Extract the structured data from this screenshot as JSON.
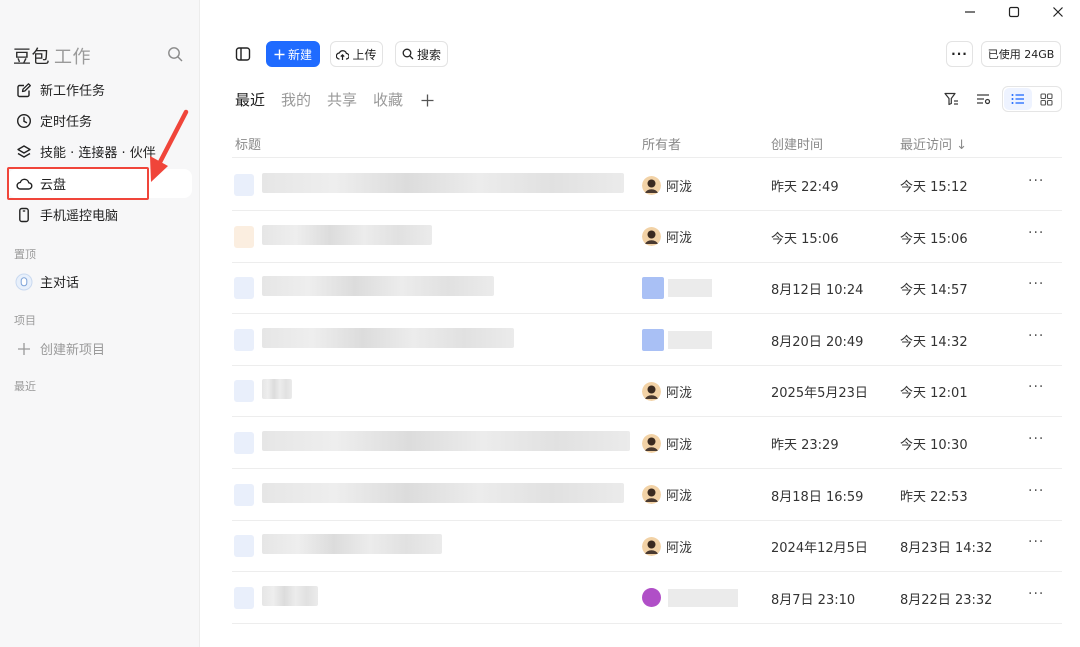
{
  "window": {
    "controls": [
      "minimize",
      "maximize",
      "close"
    ]
  },
  "sidebar": {
    "brand": "豆包",
    "brand_sub": "工作",
    "nav": [
      {
        "label": "新工作任务",
        "icon": "edit-icon"
      },
      {
        "label": "定时任务",
        "icon": "clock-icon"
      },
      {
        "label": "技能 · 连接器 · 伙伴",
        "icon": "layers-icon"
      },
      {
        "label": "云盘",
        "icon": "cloud-icon",
        "active": true
      },
      {
        "label": "手机遥控电脑",
        "icon": "phone-icon"
      }
    ],
    "pinned_label": "置顶",
    "pinned_item": "主对话",
    "projects_label": "项目",
    "new_project": "创建新项目",
    "recent_label": "最近"
  },
  "toolbar": {
    "new_label": "新建",
    "upload_label": "上传",
    "search_label": "搜索",
    "usage_label": "已使用 24GB"
  },
  "tabs": [
    {
      "label": "最近",
      "active": true
    },
    {
      "label": "我的"
    },
    {
      "label": "共享"
    },
    {
      "label": "收藏"
    }
  ],
  "table": {
    "columns": {
      "title": "标题",
      "owner": "所有者",
      "created": "创建时间",
      "visited": "最近访问 ↓"
    },
    "rows": [
      {
        "owner": "阿泷",
        "owner_type": "photo",
        "created": "昨天 22:49",
        "visited": "今天 15:12",
        "more": "···"
      },
      {
        "owner": "阿泷",
        "owner_type": "photo",
        "created": "今天 15:06",
        "visited": "今天 15:06",
        "more": "···"
      },
      {
        "owner": "",
        "owner_type": "blurred",
        "created": "8月12日 10:24",
        "visited": "今天 14:57",
        "more": "···"
      },
      {
        "owner": "",
        "owner_type": "blurred",
        "created": "8月20日 20:49",
        "visited": "今天 14:32",
        "more": "···"
      },
      {
        "owner": "阿泷",
        "owner_type": "photo",
        "created": "2025年5月23日",
        "visited": "今天 12:01",
        "more": "···"
      },
      {
        "owner": "阿泷",
        "owner_type": "photo",
        "created": "昨天 23:29",
        "visited": "今天 10:30",
        "more": "···"
      },
      {
        "owner": "阿泷",
        "owner_type": "photo",
        "created": "8月18日 16:59",
        "visited": "昨天 22:53",
        "more": "···"
      },
      {
        "owner": "阿泷",
        "owner_type": "photo",
        "created": "2024年12月5日",
        "visited": "8月23日 14:32",
        "more": "···"
      },
      {
        "owner": "",
        "owner_type": "purple-blurred",
        "created": "8月7日 23:10",
        "visited": "8月22日 23:32",
        "more": "···"
      }
    ]
  },
  "colors": {
    "accent": "#1f6bff",
    "annotation": "#f0453a",
    "sidebar_bg": "#f7f7f8"
  }
}
